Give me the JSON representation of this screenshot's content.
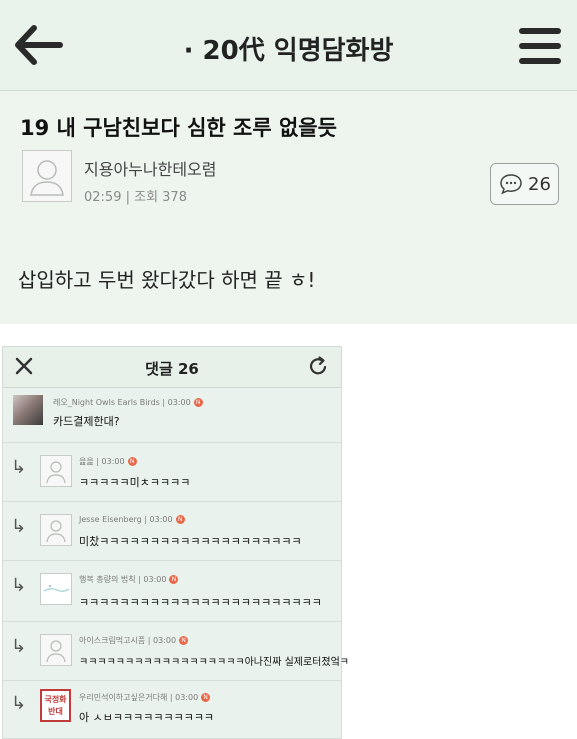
{
  "header": {
    "title": "· 20代 익명담화방"
  },
  "post": {
    "title": "19 내 구남친보다 심한 조루 없을듯",
    "author": "지용아누나한테오렴",
    "meta": "02:59 | 조회 378",
    "comment_count": "26",
    "body": "삽입하고 두번 왔다갔다 하면 끝 ㅎ!"
  },
  "comments_panel": {
    "title": "댓글 26",
    "comments": [
      {
        "author": "레오_Night Owls Earls Birds",
        "time": "03:00",
        "badge": "N",
        "text": "카드결제한대?"
      },
      {
        "author": "읊읊",
        "time": "03:00",
        "badge": "N",
        "text": "ㅋㅋㅋㅋㅋ미ㅊㅋㅋㅋㅋ"
      },
      {
        "author": "Jesse Eisenberg",
        "time": "03:00",
        "badge": "N",
        "text": "미찼ㅋㅋㅋㅋㅋㅋㅋㅋㅋㅋㅋㅋㅋㅋㅋㅋㅋㅋㅋㅋ"
      },
      {
        "author": "행복 총량의 법칙",
        "time": "03:00",
        "badge": "N",
        "text": "ㅋㅋㅋㅋㅋㅋㅋㅋㅋㅋㅋㅋㅋㅋㅋㅋㅋㅋㅋㅋㅋㅋㅋㅋ"
      },
      {
        "author": "아이스크림먹고시픔",
        "time": "03:00",
        "badge": "N",
        "text": "ㅋㅋㅋㅋㅋㅋㅋㅋㅋㅋㅋㅋㅋㅋㅋㅋㅋㅋ아나진짜 실제로터졌엌ㅋ"
      },
      {
        "author": "우리민석이하고싶은거다해",
        "time": "03:00",
        "badge": "N",
        "text": "아 ㅅㅂㅋㅋㅋㅋㅋㅋㅋㅋㅋㅋ",
        "avatar_text": "국정화 반대"
      }
    ]
  },
  "colors": {
    "badge": "#e8684a",
    "panel_bg": "#eaf2ed",
    "stamp_red": "#c23a3a"
  }
}
